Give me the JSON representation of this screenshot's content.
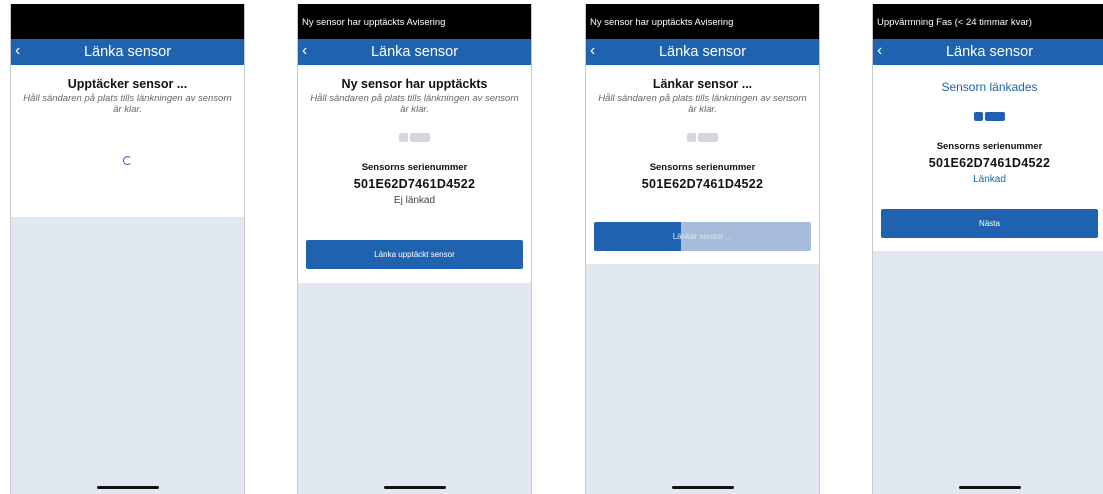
{
  "phones": [
    {
      "status": "",
      "nav": {
        "back": "‹",
        "title": "Länka sensor"
      },
      "heading": "Upptäcker sensor ...",
      "hint": "Håll sändaren på plats tills länkningen av sensorn är klar."
    },
    {
      "status": "Ny sensor har upptäckts Avisering",
      "nav": {
        "back": "‹",
        "title": "Länka sensor"
      },
      "heading": "Ny sensor har upptäckts",
      "hint": "Håll sändaren på plats tills länkningen av sensorn är klar.",
      "serial_label": "Sensorns serienummer",
      "serial": "501E62D7461D4522",
      "state": "Ej länkad",
      "button": "Länka upptäckt sensor"
    },
    {
      "status": "Ny sensor har upptäckts Avisering",
      "nav": {
        "back": "‹",
        "title": "Länka sensor"
      },
      "heading": "Länkar sensor ...",
      "hint": "Håll sändaren på plats tills länkningen av sensorn är klar.",
      "serial_label": "Sensorns serienummer",
      "serial": "501E62D7461D4522",
      "button": "Länkar sensor ...",
      "progress": 0.4
    },
    {
      "status": "Uppvärmning Fas (< 24 timmar kvar)",
      "nav": {
        "back": "‹",
        "title": "Länka sensor"
      },
      "heading": "Sensorn länkades",
      "serial_label": "Sensorns serienummer",
      "serial": "501E62D7461D4522",
      "state": "Länkad",
      "button": "Nästa"
    }
  ],
  "colors": {
    "brand": "#1f63b0",
    "background": "#e1e8f2"
  }
}
